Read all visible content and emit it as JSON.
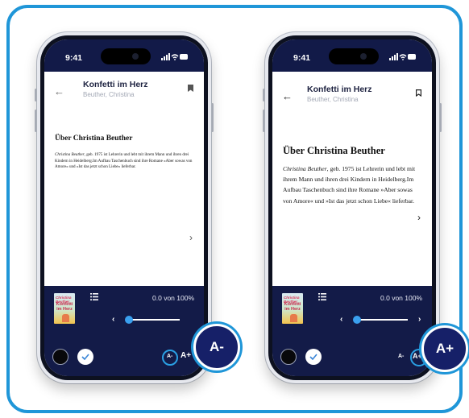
{
  "book": {
    "title": "Konfetti im Herz",
    "author": "Beuther, Christina",
    "cover_top": "Christina Beuther",
    "cover_title": "Konfetti im Herz"
  },
  "status": {
    "time": "9:41"
  },
  "content": {
    "heading": "Über Christina Beuther",
    "author_name": "Christina Beuther",
    "body": ", geb. 1975 ist Lehrerin und lebt mit ihrem Mann und ihren drei Kindern in Heidelberg.Im Aufbau Taschenbuch sind ihre Romane »Aber sowas von Amore« und »Ist das jetzt schon Liebe« lieferbar."
  },
  "reader": {
    "progress": "0.0 von 100%",
    "progress_value": 0,
    "font_smaller": "A-",
    "font_larger": "A+"
  },
  "callouts": {
    "left": "A-",
    "right": "A+"
  },
  "colors": {
    "frame": "#1f96d8",
    "panel": "#131b48",
    "accent": "#3aa0ef",
    "callout_fill": "#162068"
  },
  "icons": {
    "back": "back-arrow-icon",
    "bookmark_left": "bookmark-filled-icon",
    "bookmark_right": "bookmark-outline-icon",
    "list": "list-icon",
    "check": "check-icon",
    "next": "chevron-right-icon",
    "prev": "chevron-left-icon"
  }
}
